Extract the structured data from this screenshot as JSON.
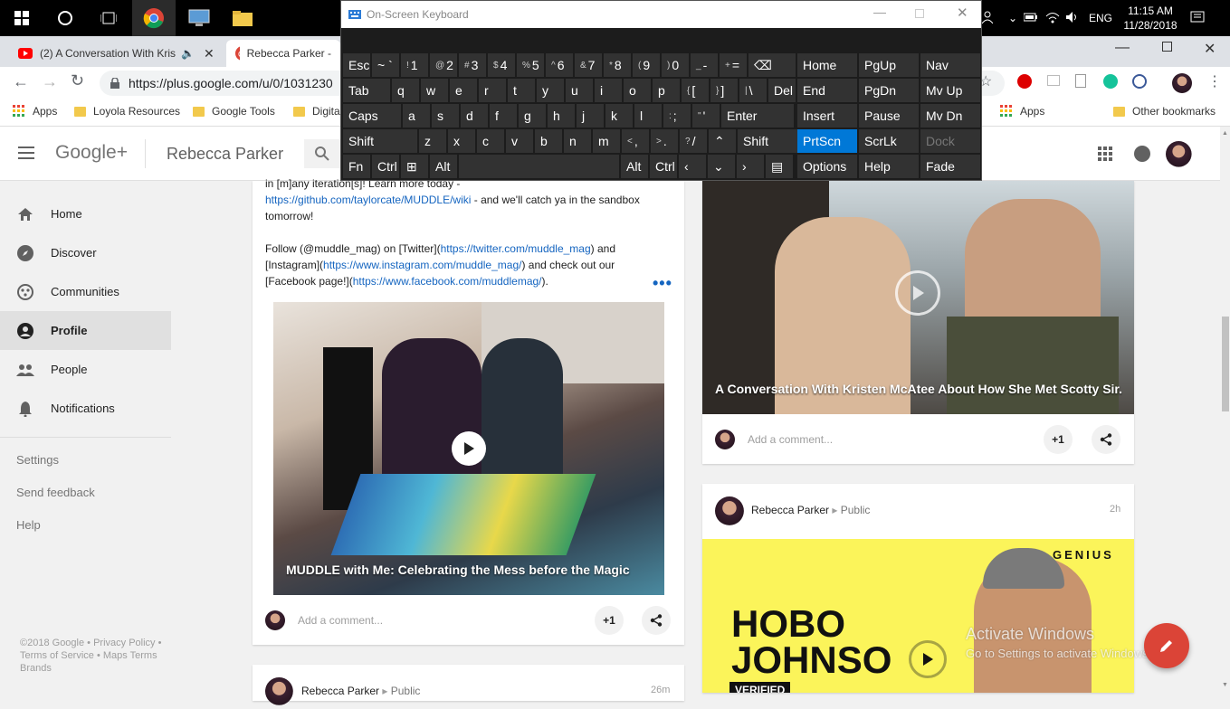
{
  "taskbar": {
    "language": "ENG",
    "time": "11:15 AM",
    "date": "11/28/2018"
  },
  "browser": {
    "tabs": [
      {
        "title": "(2) A Conversation With Krist"
      },
      {
        "title": "Rebecca Parker -"
      }
    ],
    "url": "https://plus.google.com/u/0/1031230",
    "bookmarks": [
      "Apps",
      "Loyola Resources",
      "Google Tools",
      "Digita"
    ],
    "bookmarks_right": [
      "Apps",
      "Other bookmarks"
    ]
  },
  "gplus": {
    "logo": "Google+",
    "page_title": "Rebecca Parker"
  },
  "sidebar": {
    "items": [
      {
        "label": "Home",
        "icon": "home-icon"
      },
      {
        "label": "Discover",
        "icon": "compass-icon"
      },
      {
        "label": "Communities",
        "icon": "communities-icon"
      },
      {
        "label": "Profile",
        "icon": "profile-icon"
      },
      {
        "label": "People",
        "icon": "people-icon"
      },
      {
        "label": "Notifications",
        "icon": "bell-icon"
      }
    ],
    "links": [
      "Settings",
      "Send feedback",
      "Help"
    ],
    "footer": {
      "copyright": "©2018 Google",
      "privacy": "Privacy Policy",
      "terms": "Terms of Service",
      "maps_terms": "Maps Terms",
      "brands": "Brands"
    }
  },
  "post1": {
    "text_top": "in [m]any iteration[s]! Learn more today -",
    "link_wiki": "https://github.com/taylorcate/MUDDLE/wiki",
    "text_after_wiki": " - and we'll catch ya in the sandbox",
    "text_tomorrow": "tomorrow!",
    "text_follow": "Follow (@muddle_mag) on [Twitter](",
    "link_twitter": "https://twitter.com/muddle_mag",
    "text_and": ") and",
    "text_instagram": "[Instagram](",
    "link_instagram": "https://www.instagram.com/muddle_mag/",
    "text_checkout": ")  and check out our",
    "text_facebook": "[Facebook page!](",
    "link_facebook": "https://www.facebook.com/muddlemag/",
    "text_end": ").",
    "video_title": "MUDDLE with Me: Celebrating the Mess before the Magic",
    "comment_placeholder": "Add a comment...",
    "plus_one": "+1"
  },
  "post2_preview": {
    "author": "Rebecca Parker",
    "visibility": "Public",
    "age": "26m"
  },
  "post3": {
    "video_title": "A Conversation With Kristen McAtee About How She Met Scotty Sir...",
    "comment_placeholder": "Add a comment...",
    "plus_one": "+1"
  },
  "post4": {
    "author": "Rebecca Parker",
    "visibility": "Public",
    "age": "2h",
    "thumb_brand": "GENIUS",
    "thumb_line1": "HOBO",
    "thumb_line2": "JOHNSO",
    "thumb_badge": "VERIFIED"
  },
  "watermark": {
    "line1": "Activate Windows",
    "line2": "Go to Settings to activate Windows."
  },
  "osk": {
    "title": "On-Screen Keyboard",
    "rows": [
      [
        [
          "Esc",
          ""
        ],
        [
          "~ `",
          ""
        ],
        [
          "1",
          "!"
        ],
        [
          "2",
          "@"
        ],
        [
          "3",
          "#"
        ],
        [
          "4",
          "$"
        ],
        [
          "5",
          "%"
        ],
        [
          "6",
          "^"
        ],
        [
          "7",
          "&"
        ],
        [
          "8",
          "*"
        ],
        [
          "9",
          "("
        ],
        [
          "0",
          ")"
        ],
        [
          "-",
          "_"
        ],
        [
          "=",
          "+"
        ],
        [
          "⌫",
          ""
        ]
      ],
      [
        [
          "Tab",
          ""
        ],
        [
          "q",
          ""
        ],
        [
          "w",
          ""
        ],
        [
          "e",
          ""
        ],
        [
          "r",
          ""
        ],
        [
          "t",
          ""
        ],
        [
          "y",
          ""
        ],
        [
          "u",
          ""
        ],
        [
          "i",
          ""
        ],
        [
          "o",
          ""
        ],
        [
          "p",
          ""
        ],
        [
          "[",
          "{"
        ],
        [
          "]",
          "}"
        ],
        [
          "\\",
          "|"
        ],
        [
          "Del",
          ""
        ]
      ],
      [
        [
          "Caps",
          ""
        ],
        [
          "a",
          ""
        ],
        [
          "s",
          ""
        ],
        [
          "d",
          ""
        ],
        [
          "f",
          ""
        ],
        [
          "g",
          ""
        ],
        [
          "h",
          ""
        ],
        [
          "j",
          ""
        ],
        [
          "k",
          ""
        ],
        [
          "l",
          ""
        ],
        [
          ";",
          ":"
        ],
        [
          "'",
          "\""
        ],
        [
          "Enter",
          ""
        ]
      ],
      [
        [
          "Shift",
          ""
        ],
        [
          "z",
          ""
        ],
        [
          "x",
          ""
        ],
        [
          "c",
          ""
        ],
        [
          "v",
          ""
        ],
        [
          "b",
          ""
        ],
        [
          "n",
          ""
        ],
        [
          "m",
          ""
        ],
        [
          ",",
          "<"
        ],
        [
          ".",
          ">"
        ],
        [
          "/",
          "?"
        ],
        [
          "⌃",
          ""
        ],
        [
          "Shift",
          ""
        ]
      ],
      [
        [
          "Fn",
          ""
        ],
        [
          "Ctrl",
          ""
        ],
        [
          "⊞",
          ""
        ],
        [
          "Alt",
          ""
        ],
        [
          "",
          ""
        ],
        [
          "Alt",
          ""
        ],
        [
          "Ctrl",
          ""
        ],
        [
          "‹",
          ""
        ],
        [
          "⌄",
          ""
        ],
        [
          "›",
          ""
        ],
        [
          "▤",
          ""
        ]
      ]
    ],
    "nav": [
      [
        "Home",
        "PgUp",
        "Nav"
      ],
      [
        "End",
        "PgDn",
        "Mv Up"
      ],
      [
        "Insert",
        "Pause",
        "Mv Dn"
      ],
      [
        "PrtScn",
        "ScrLk",
        "Dock"
      ],
      [
        "Options",
        "Help",
        "Fade"
      ]
    ]
  }
}
